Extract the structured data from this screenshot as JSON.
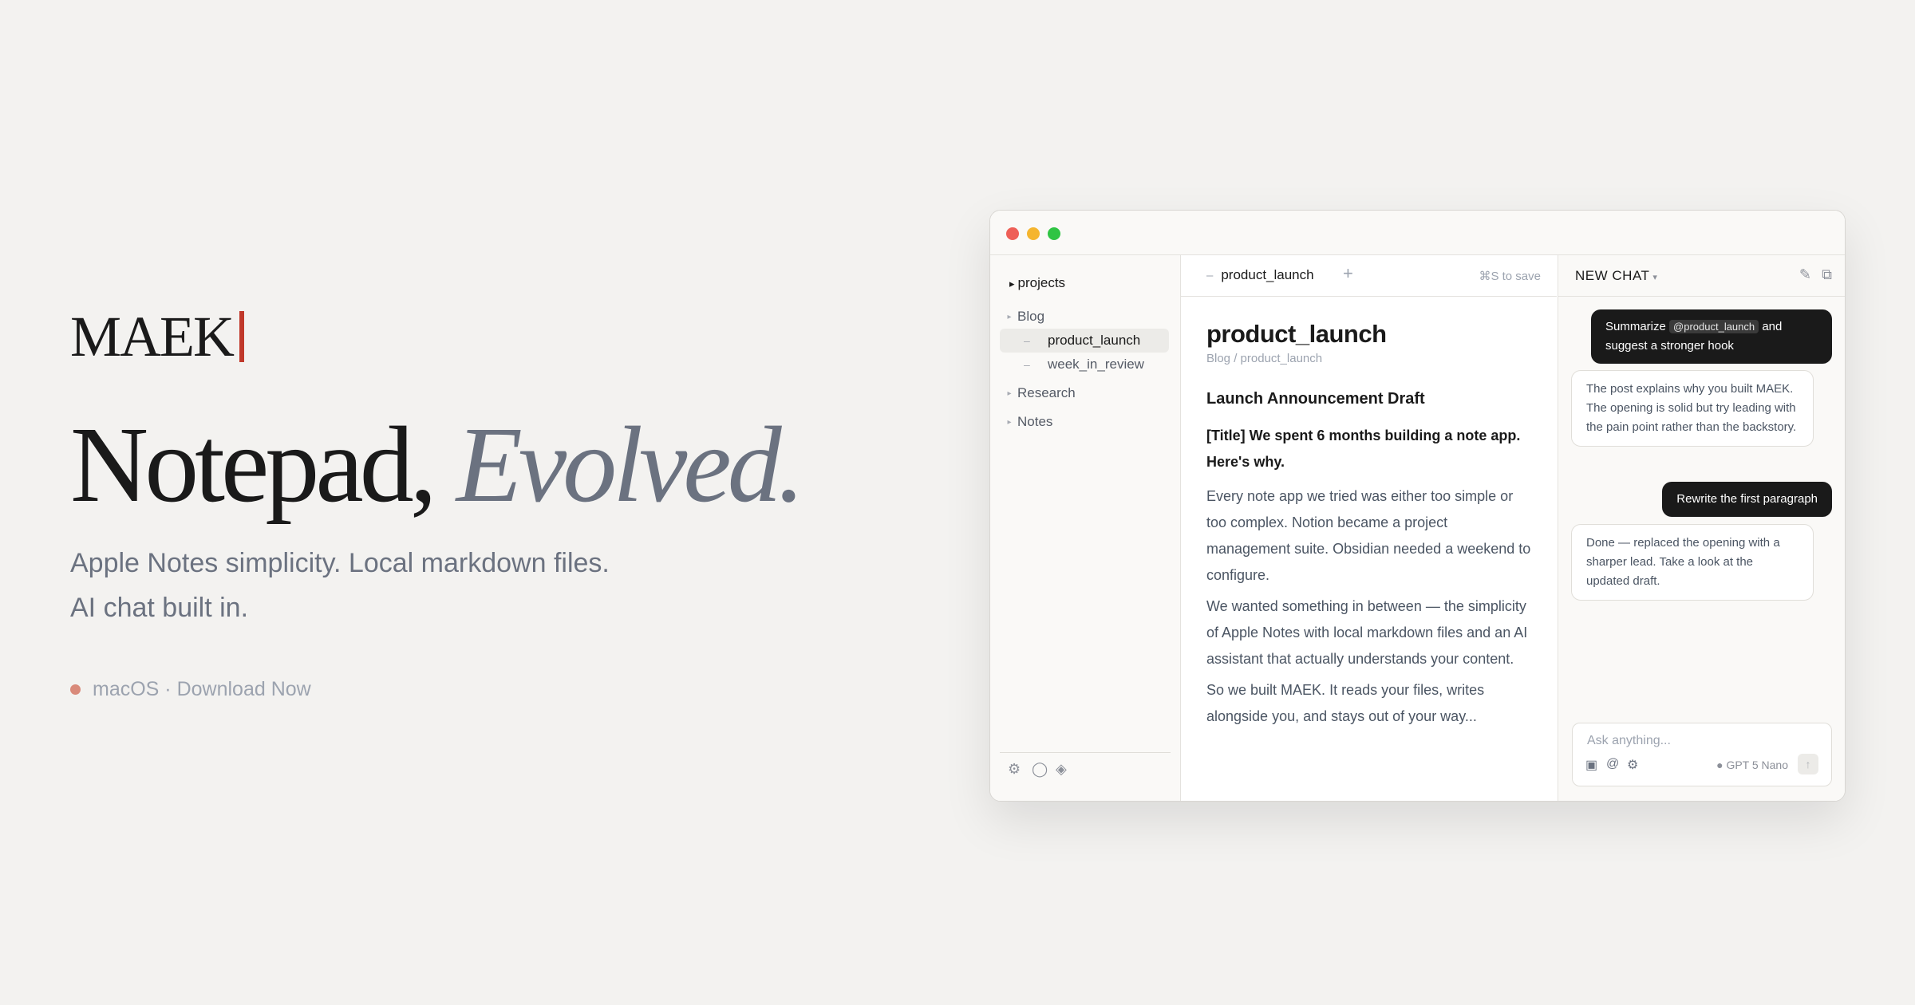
{
  "hero": {
    "brand": "MAEK",
    "headline_main": "Notepad,",
    "headline_accent": "Evolved.",
    "subline_1": "Apple Notes simplicity. Local markdown files.",
    "subline_2": "AI chat built in.",
    "cta_text": "macOS · Download Now"
  },
  "sidebar": {
    "root_label": "projects",
    "root_caret": "▸",
    "folders": {
      "blog": "Blog",
      "research": "Research",
      "notes": "Notes"
    },
    "files": {
      "product_launch": "product_launch",
      "week_in_review": "week_in_review"
    },
    "selected_file": "product_launch",
    "footer_icons": [
      "gear-icon",
      "circle-icon",
      "diamond-icon"
    ]
  },
  "editor": {
    "tab_label": "product_launch",
    "add_tab": "+",
    "save_hint": "⌘S to save",
    "doc": {
      "title": "product_launch",
      "path": "Blog / product_launch",
      "heading": "Launch Announcement Draft",
      "bold_line": "[Title] We spent 6 months building a note app. Here's why.",
      "paragraphs": [
        "Every note app we tried was either too simple or too complex. Notion became a project management suite. Obsidian needed a weekend to configure.",
        "We wanted something in between — the simplicity of Apple Notes with local markdown files and an AI assistant that actually understands your content.",
        "So we built MAEK. It reads your files, writes alongside you, and stays out of your way..."
      ]
    }
  },
  "chat": {
    "title": "NEW CHAT",
    "title_chevron": "▾",
    "messages": [
      {
        "role": "user",
        "text_before": "Summarize",
        "mention": "@product_launch",
        "text_after": "and suggest a stronger hook"
      },
      {
        "role": "ai",
        "text": "The post explains why you built MAEK. The opening is solid but try leading with the pain point rather than the backstory."
      },
      {
        "role": "user",
        "text": "Rewrite the first paragraph"
      },
      {
        "role": "ai",
        "text": "Done — replaced the opening with a sharper lead. Take a look at the updated draft."
      }
    ],
    "input_placeholder": "Ask anything...",
    "model": "● GPT 5 Nano",
    "send": "↑"
  },
  "colors": {
    "background": "#f3f2f0",
    "cursor_accent": "#c0392b",
    "accent_text": "#6b7280",
    "cta_dot": "#d98a7a",
    "traffic_red": "#ee5f57",
    "traffic_yellow": "#f5b52e",
    "traffic_green": "#2fc443"
  }
}
